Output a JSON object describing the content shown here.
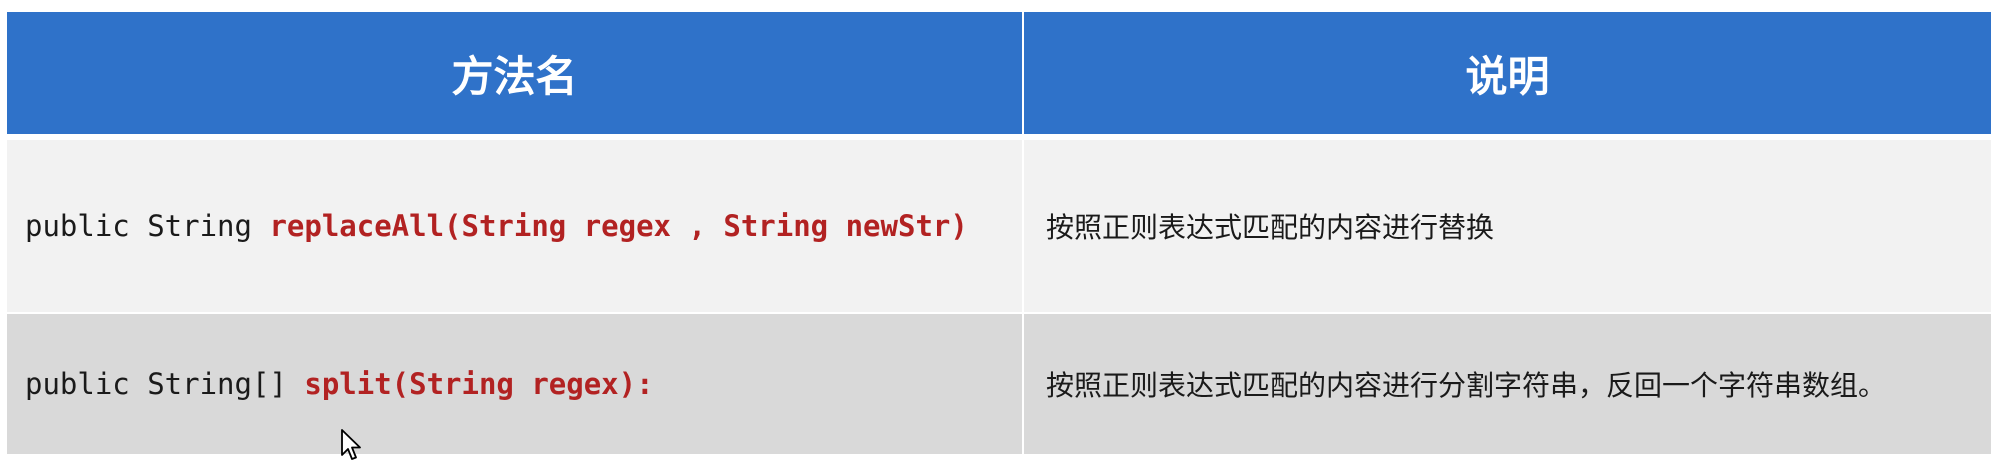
{
  "table": {
    "headers": [
      "方法名",
      "说明"
    ],
    "rows": [
      {
        "method_prefix": "public String ",
        "method_highlight": "replaceAll(String regex , String newStr)",
        "description": "按照正则表达式匹配的内容进行替换"
      },
      {
        "method_prefix": "public String[] ",
        "method_highlight": "split(String regex):",
        "description": "按照正则表达式匹配的内容进行分割字符串，反回一个字符串数组。"
      }
    ]
  },
  "colors": {
    "header_bg": "#2f72c9",
    "header_text": "#ffffff",
    "row1_bg": "#f2f2f2",
    "row2_bg": "#d9d9d9",
    "method_highlight": "#b22222"
  },
  "icons": {
    "cursor": "mouse-pointer-icon"
  }
}
